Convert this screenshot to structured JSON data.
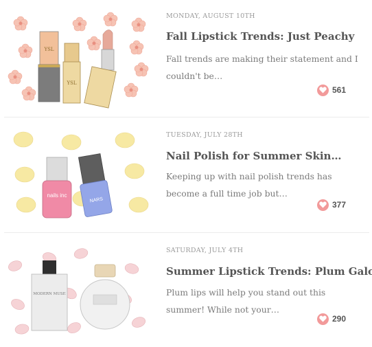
{
  "posts": [
    {
      "date": "MONDAY, AUGUST 10TH",
      "title": "Fall Lipstick Trends: Just Peachy",
      "excerpt": "Fall trends are making their statement and I couldn't be…",
      "likes": "561",
      "thumbnail_labels": [
        "YSL",
        "YSL"
      ]
    },
    {
      "date": "TUESDAY, JULY 28TH",
      "title": "Nail Polish for Summer Skin…",
      "excerpt": "Keeping up with nail polish trends has become a full time job but…",
      "likes": "377",
      "thumbnail_labels": [
        "nails inc",
        "NARS"
      ]
    },
    {
      "date": "SATURDAY, JULY 4TH",
      "title": "Summer Lipstick Trends: Plum Galore",
      "excerpt": "Plum lips will help you stand out this summer! While not your…",
      "likes": "290",
      "thumbnail_labels": [
        "MODERN MUSE"
      ]
    }
  ],
  "colors": {
    "heart": "#f29a9a",
    "title": "#555555",
    "meta": "#9a9a9a",
    "excerpt": "#7a7a7a",
    "divider": "#ececec"
  },
  "icons": [
    "heart-icon"
  ]
}
